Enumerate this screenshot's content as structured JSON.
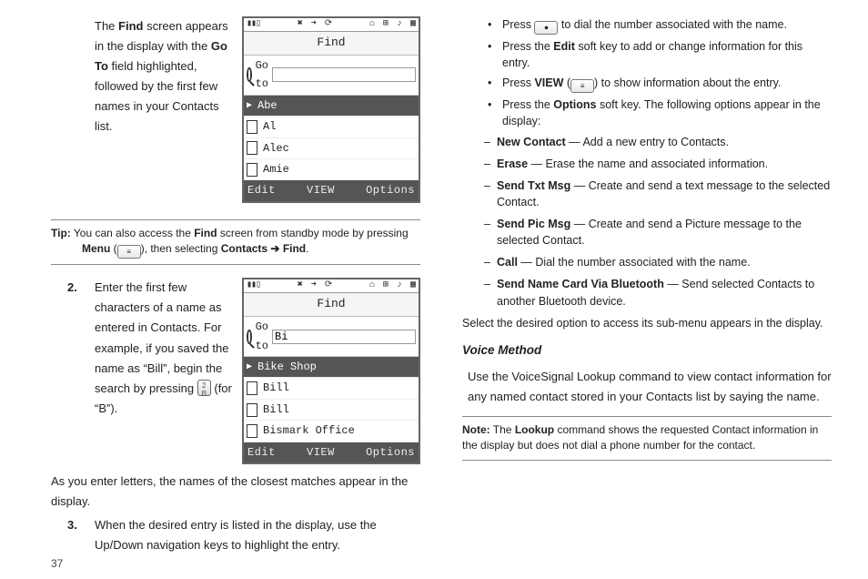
{
  "page_number": "37",
  "left": {
    "intro_pre": "The ",
    "intro_b1": "Find",
    "intro_mid1": " screen appears in the display with the ",
    "intro_b2": "Go To",
    "intro_post": " field highlighted, followed by the first few names in your Contacts list.",
    "tip_label": "Tip:",
    "tip_text_pre": " You can also access the ",
    "tip_b1": "Find",
    "tip_text_mid1": " screen from standby mode by pressing ",
    "tip_b2": "Menu",
    "tip_text_mid2": " (",
    "tip_text_mid3": "), then selecting ",
    "tip_b3": "Contacts ➔ Find",
    "tip_text_end": ".",
    "step2_num": "2.",
    "step2": "Enter the first few characters of a name as entered in Contacts. For example, if you saved the name as “Bill”, begin the search by pressing ",
    "step2_key_label": "2\nB",
    "step2_tail": " (for “B”).",
    "step2_after": "As you enter letters, the names of the closest matches appear in the display.",
    "step3_num": "3.",
    "step3": "When the desired entry is listed in the display, use the Up/Down navigation keys to highlight the entry."
  },
  "phone_common": {
    "signal": "▮▮▯",
    "top_icons": [
      "✖",
      "➜",
      "⟳"
    ],
    "right_icons": [
      "⌂",
      "⊞",
      "♪",
      "▦"
    ],
    "title": "Find",
    "goto": "Go to",
    "sk_left": "Edit",
    "sk_center": "VIEW",
    "sk_right": "Options"
  },
  "phone1": {
    "input": "",
    "selected": "Abe",
    "rows": [
      "Al",
      "Alec",
      "Amie"
    ]
  },
  "phone2": {
    "input": "Bi",
    "selected": "Bike Shop",
    "rows": [
      "Bill",
      "Bill",
      "Bismark Office"
    ]
  },
  "right": {
    "b1_pre": "Press ",
    "b1_post": " to dial the number associated with the name.",
    "b2_pre": "Press the ",
    "b2_b": "Edit",
    "b2_post": " soft key to add or change information for this entry.",
    "b3_pre": "Press ",
    "b3_b": "VIEW",
    "b3_mid": " (",
    "b3_post": ") to show information about the entry.",
    "b4_pre": "Press the ",
    "b4_b": "Options",
    "b4_post": " soft key. The following options appear in the display:",
    "s1_b": "New Contact",
    "s1_t": " — Add a new entry to Contacts.",
    "s2_b": "Erase",
    "s2_t": " — Erase the name and associated information.",
    "s3_b": "Send Txt Msg",
    "s3_t": " — Create and send a text message to the selected Contact.",
    "s4_b": "Send Pic Msg",
    "s4_t": " — Create and send a Picture message to the selected Contact.",
    "s5_b": "Call",
    "s5_t": " — Dial the number associated with the name.",
    "s6_b": "Send Name Card Via Bluetooth",
    "s6_t": " — Send selected Contacts to another Bluetooth device.",
    "s_after": "Select the desired option to access its sub-menu appears in the display.",
    "voice_head": "Voice Method",
    "voice_body": "Use the VoiceSignal Lookup command to view contact information for any named contact stored in your Contacts list by saying the name.",
    "note_label": "Note:",
    "note_pre": " The ",
    "note_b": "Lookup",
    "note_post": " command shows the requested Contact information in the display but does not dial a phone number for the contact."
  }
}
